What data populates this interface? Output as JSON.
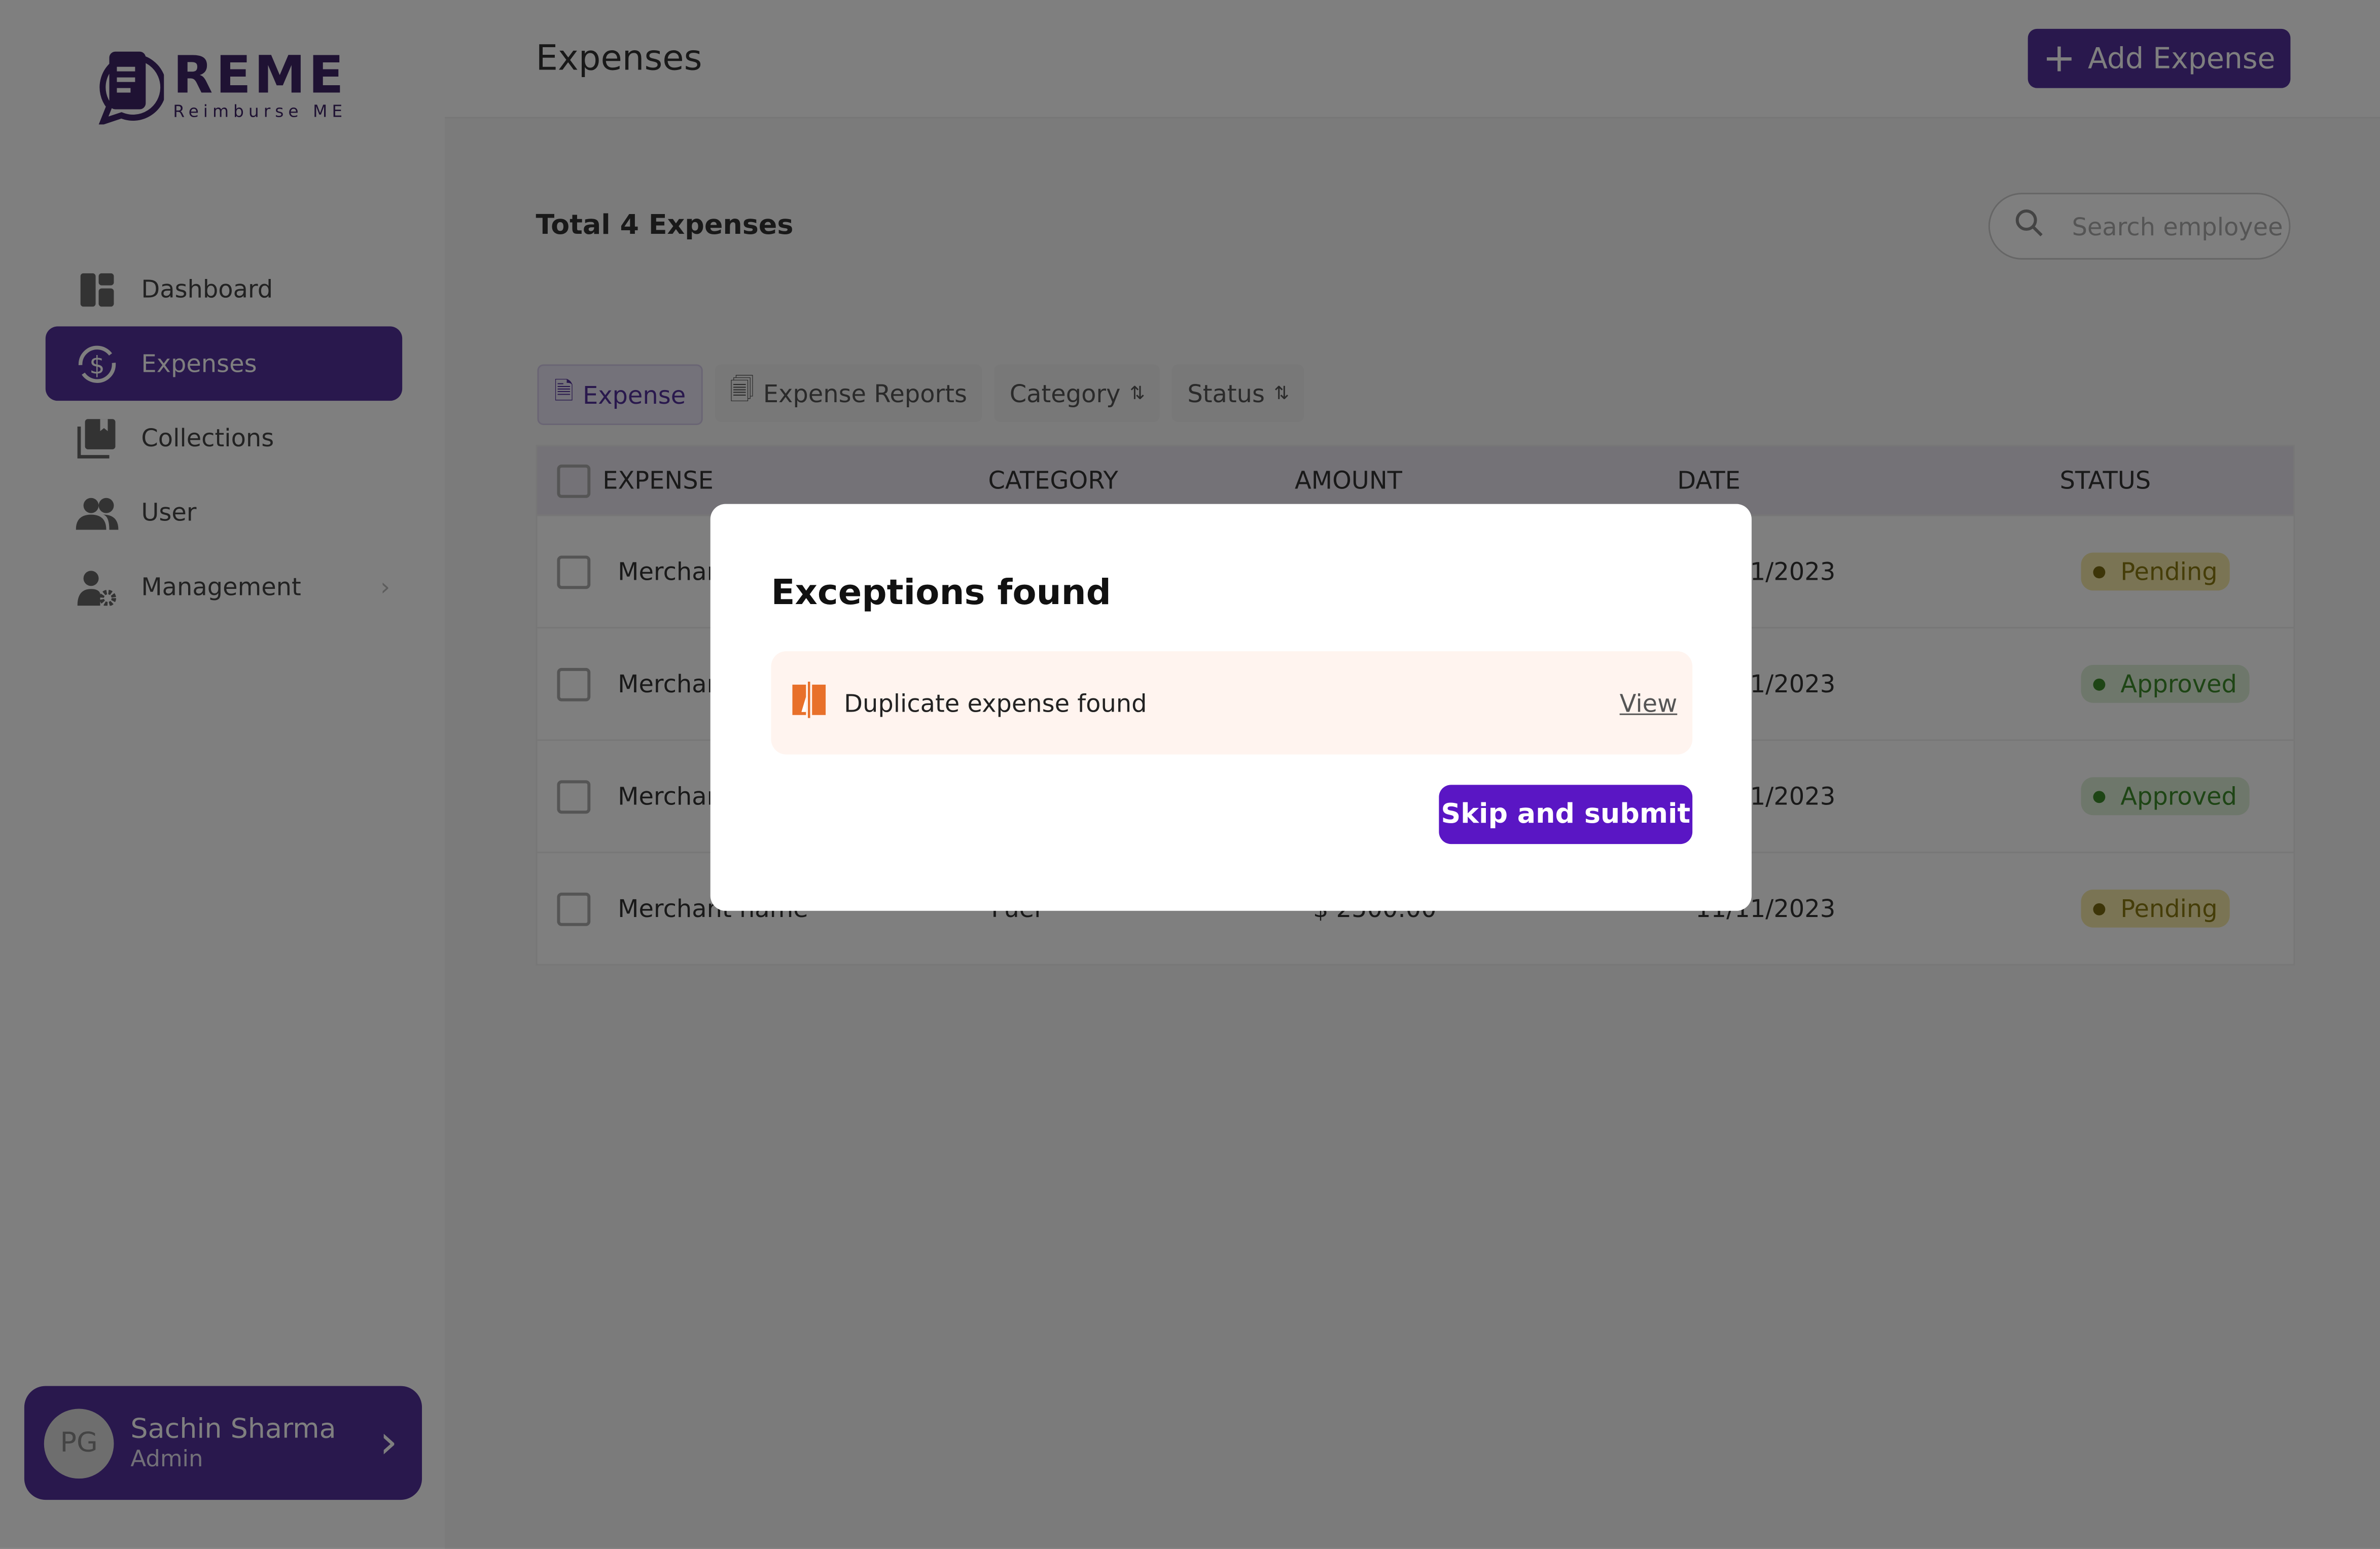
{
  "brand": {
    "name": "REME",
    "tagline": "Reimburse ME",
    "color": "#3f2566"
  },
  "sidebar": {
    "items": [
      {
        "label": "Dashboard",
        "icon": "dashboard-icon"
      },
      {
        "label": "Expenses",
        "icon": "dollar-sync-icon",
        "active": true
      },
      {
        "label": "Collections",
        "icon": "collections-icon"
      },
      {
        "label": "User",
        "icon": "users-icon"
      },
      {
        "label": "Management",
        "icon": "user-gear-icon"
      }
    ]
  },
  "user": {
    "initials": "PG",
    "name": "Sachin Sharma",
    "role": "Admin"
  },
  "header": {
    "title": "Expenses",
    "add_label": "Add Expense"
  },
  "summary": {
    "total": "Total 4 Expenses"
  },
  "search": {
    "placeholder": "Search employee"
  },
  "filters": {
    "expense": "Expense",
    "reports": "Expense Reports",
    "category": "Category",
    "status": "Status"
  },
  "table": {
    "headers": [
      "EXPENSE",
      "CATEGORY",
      "AMOUNT",
      "DATE",
      "STATUS"
    ],
    "rows": [
      {
        "expense": "Merchant name",
        "category": "",
        "amount": "",
        "date": "11/11/2023",
        "status": "Pending"
      },
      {
        "expense": "Merchant name",
        "category": "",
        "amount": "",
        "date": "11/11/2023",
        "status": "Approved"
      },
      {
        "expense": "Merchant name",
        "category": "",
        "amount": "",
        "date": "11/11/2023",
        "status": "Approved"
      },
      {
        "expense": "Merchant name",
        "category": "Fuel",
        "amount": "$ 2500.00",
        "date": "11/11/2023",
        "status": "Pending"
      }
    ]
  },
  "colors": {
    "accent": "#52309a",
    "pending": "#f5e9a8",
    "approved": "#dcefd6",
    "submit": "#5a16c4"
  },
  "modal": {
    "title": "Exceptions found",
    "exception": "Duplicate expense found",
    "view_label": "View",
    "submit_label": "Skip and submit"
  }
}
